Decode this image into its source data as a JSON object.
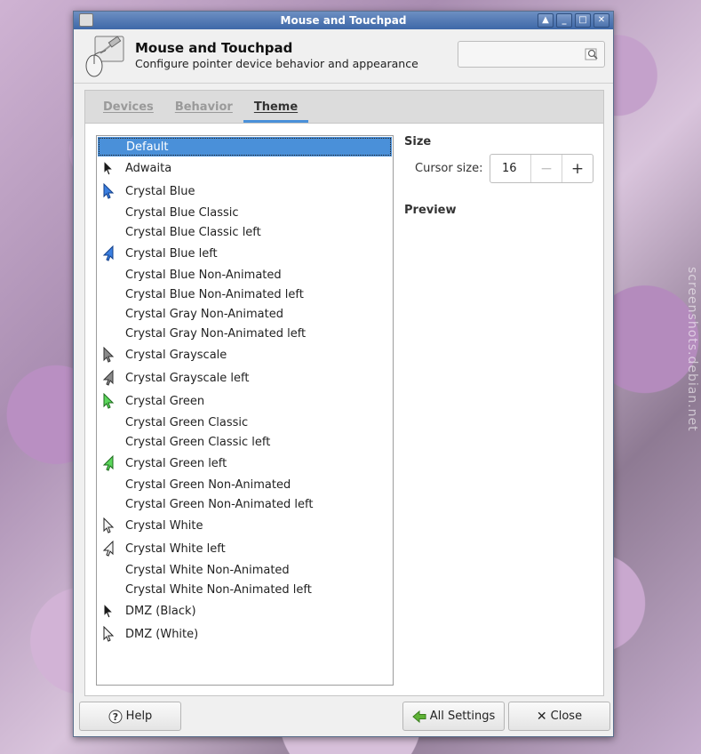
{
  "window": {
    "title": "Mouse and Touchpad",
    "controls": [
      "up-arrow-icon",
      "minimize-icon",
      "maximize-icon",
      "close-icon"
    ]
  },
  "header": {
    "title": "Mouse and Touchpad",
    "subtitle": "Configure pointer device behavior and appearance",
    "search_placeholder": ""
  },
  "tabs": [
    {
      "label": "Devices",
      "active": false
    },
    {
      "label": "Behavior",
      "active": false
    },
    {
      "label": "Theme",
      "active": true
    }
  ],
  "themes": [
    {
      "name": "Default",
      "icon": "none",
      "selected": true
    },
    {
      "name": "Adwaita",
      "icon": "black-arrow"
    },
    {
      "name": "Crystal Blue",
      "icon": "blue-arrow"
    },
    {
      "name": "Crystal Blue Classic",
      "icon": "none"
    },
    {
      "name": "Crystal Blue Classic left",
      "icon": "none"
    },
    {
      "name": "Crystal Blue left",
      "icon": "blue-arrow-left"
    },
    {
      "name": "Crystal Blue Non-Animated",
      "icon": "none"
    },
    {
      "name": "Crystal Blue Non-Animated left",
      "icon": "none"
    },
    {
      "name": "Crystal Gray Non-Animated",
      "icon": "none"
    },
    {
      "name": "Crystal Gray Non-Animated left",
      "icon": "none"
    },
    {
      "name": "Crystal Grayscale",
      "icon": "gray-arrow"
    },
    {
      "name": "Crystal Grayscale left",
      "icon": "gray-arrow-left"
    },
    {
      "name": "Crystal Green",
      "icon": "green-arrow"
    },
    {
      "name": "Crystal Green Classic",
      "icon": "none"
    },
    {
      "name": "Crystal Green Classic left",
      "icon": "none"
    },
    {
      "name": "Crystal Green left",
      "icon": "green-arrow-left"
    },
    {
      "name": "Crystal Green Non-Animated",
      "icon": "none"
    },
    {
      "name": "Crystal Green Non-Animated left",
      "icon": "none"
    },
    {
      "name": "Crystal White",
      "icon": "white-arrow"
    },
    {
      "name": "Crystal White left",
      "icon": "white-arrow-left"
    },
    {
      "name": "Crystal White Non-Animated",
      "icon": "none"
    },
    {
      "name": "Crystal White Non-Animated left",
      "icon": "none"
    },
    {
      "name": "DMZ (Black)",
      "icon": "black-arrow"
    },
    {
      "name": "DMZ (White)",
      "icon": "white-arrow"
    }
  ],
  "size_section": {
    "title": "Size",
    "cursor_size_label": "Cursor size:",
    "cursor_size_value": "16",
    "minus": "−",
    "plus": "+"
  },
  "preview_section": {
    "title": "Preview"
  },
  "footer": {
    "help_label": "Help",
    "all_settings_label": "All Settings",
    "close_label": "Close"
  },
  "colors": {
    "accent": "#4a90d9",
    "titlebar": "#4a72b0"
  },
  "watermark": "screenshots.debian.net"
}
